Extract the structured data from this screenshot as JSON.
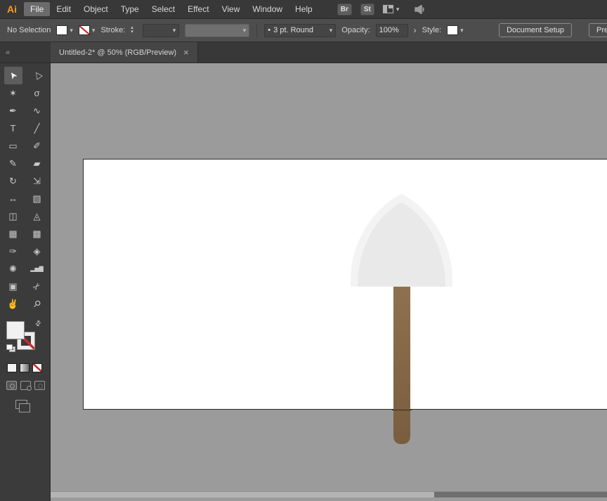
{
  "app": {
    "logo": "Ai",
    "menu": [
      "File",
      "Edit",
      "Object",
      "Type",
      "Select",
      "Effect",
      "View",
      "Window",
      "Help"
    ],
    "bridge_badge": "Br",
    "stock_badge": "St"
  },
  "icons": {
    "dropdown": "▾",
    "stepper_up": "▴",
    "stepper_down": "▾",
    "flyout": "›",
    "collapse": "«",
    "close": "×",
    "swap": "⇄",
    "bullet": "•"
  },
  "control_bar": {
    "selection_status": "No Selection",
    "stroke_label": "Stroke:",
    "brush_name": "3 pt. Round",
    "opacity_label": "Opacity:",
    "opacity_value": "100%",
    "style_label": "Style:",
    "document_setup_button": "Document Setup",
    "preferences_button": "Pref"
  },
  "tab_bar": {
    "tab_title": "Untitled-2* @ 50% (RGB/Preview)"
  },
  "tools": [
    {
      "name": "selection-tool",
      "glyph": "➤",
      "selected": true
    },
    {
      "name": "direct-selection-tool",
      "glyph": "▷"
    },
    {
      "name": "magic-wand-tool",
      "glyph": "✶"
    },
    {
      "name": "lasso-tool",
      "glyph": "σ"
    },
    {
      "name": "pen-tool",
      "glyph": "✒"
    },
    {
      "name": "curvature-tool",
      "glyph": "∿"
    },
    {
      "name": "type-tool",
      "glyph": "T"
    },
    {
      "name": "line-segment-tool",
      "glyph": "╱"
    },
    {
      "name": "rectangle-tool",
      "glyph": "▭"
    },
    {
      "name": "paintbrush-tool",
      "glyph": "✐"
    },
    {
      "name": "shaper-tool",
      "glyph": "✎"
    },
    {
      "name": "eraser-tool",
      "glyph": "▰"
    },
    {
      "name": "rotate-tool",
      "glyph": "↻"
    },
    {
      "name": "scale-tool",
      "glyph": "⇲"
    },
    {
      "name": "width-tool",
      "glyph": "↔"
    },
    {
      "name": "free-transform-tool",
      "glyph": "▧"
    },
    {
      "name": "shape-builder-tool",
      "glyph": "◫"
    },
    {
      "name": "perspective-grid-tool",
      "glyph": "◬"
    },
    {
      "name": "mesh-tool",
      "glyph": "▦"
    },
    {
      "name": "gradient-tool",
      "glyph": "▩"
    },
    {
      "name": "eyedropper-tool",
      "glyph": "✑"
    },
    {
      "name": "blend-tool",
      "glyph": "◈"
    },
    {
      "name": "symbol-sprayer-tool",
      "glyph": "✺"
    },
    {
      "name": "column-graph-tool",
      "glyph": "▂▅▇"
    },
    {
      "name": "artboard-tool",
      "glyph": "▣"
    },
    {
      "name": "slice-tool",
      "glyph": "✂"
    },
    {
      "name": "hand-tool",
      "glyph": "✌"
    },
    {
      "name": "zoom-tool",
      "glyph": "⚲"
    }
  ],
  "colors": {
    "menubar_bg": "#383838",
    "control_bg": "#4d4d4d",
    "toolbar_bg": "#3b3b3b",
    "pasteboard": "#9b9b9b",
    "logo_accent": "#ff9a1e",
    "none_red": "#cc2b2b"
  },
  "artwork": {
    "description": "shovel",
    "blade_outer": "#f3f3f3",
    "blade_inner": "#e9e9e9",
    "handle_top": "#8e7150",
    "handle_bottom": "#795d3e",
    "artboard_color": "#ffffff"
  }
}
